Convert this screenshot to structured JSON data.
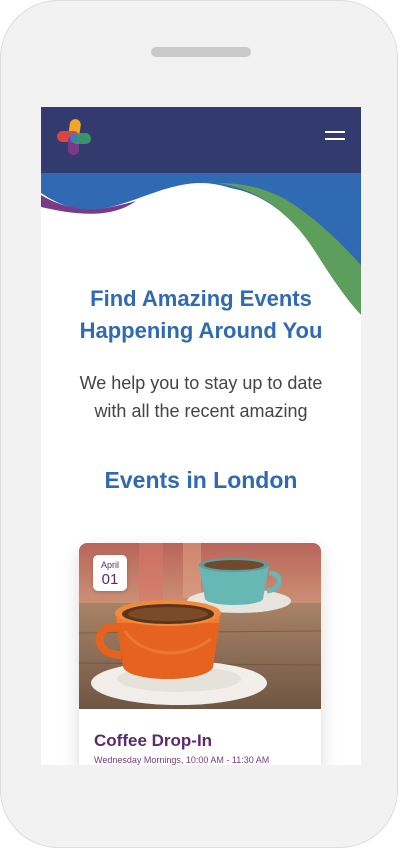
{
  "hero": {
    "headline_line1": "Find Amazing Events",
    "headline_line2": "Happening Around You",
    "subtext_line1": "We help you to stay up to date",
    "subtext_line2": "with all the recent amazing"
  },
  "events_section": {
    "title": "Events in London"
  },
  "event_card": {
    "date_month": "April",
    "date_day": "01",
    "title": "Coffee Drop-In",
    "time": "Wednesday Mornings, 10:00 AM - 11:30 AM"
  },
  "colors": {
    "header_bg": "#333a6e",
    "heading_blue": "#2f6ab3",
    "wave_blue": "#2f6ab3",
    "wave_green": "#5e9e5c",
    "wave_purple": "#7a3a86",
    "card_text_purple": "#5c2a6c"
  },
  "icons": {
    "logo": "colorful-cross-logo-icon",
    "menu": "hamburger-menu-icon",
    "speaker": "phone-speaker"
  }
}
